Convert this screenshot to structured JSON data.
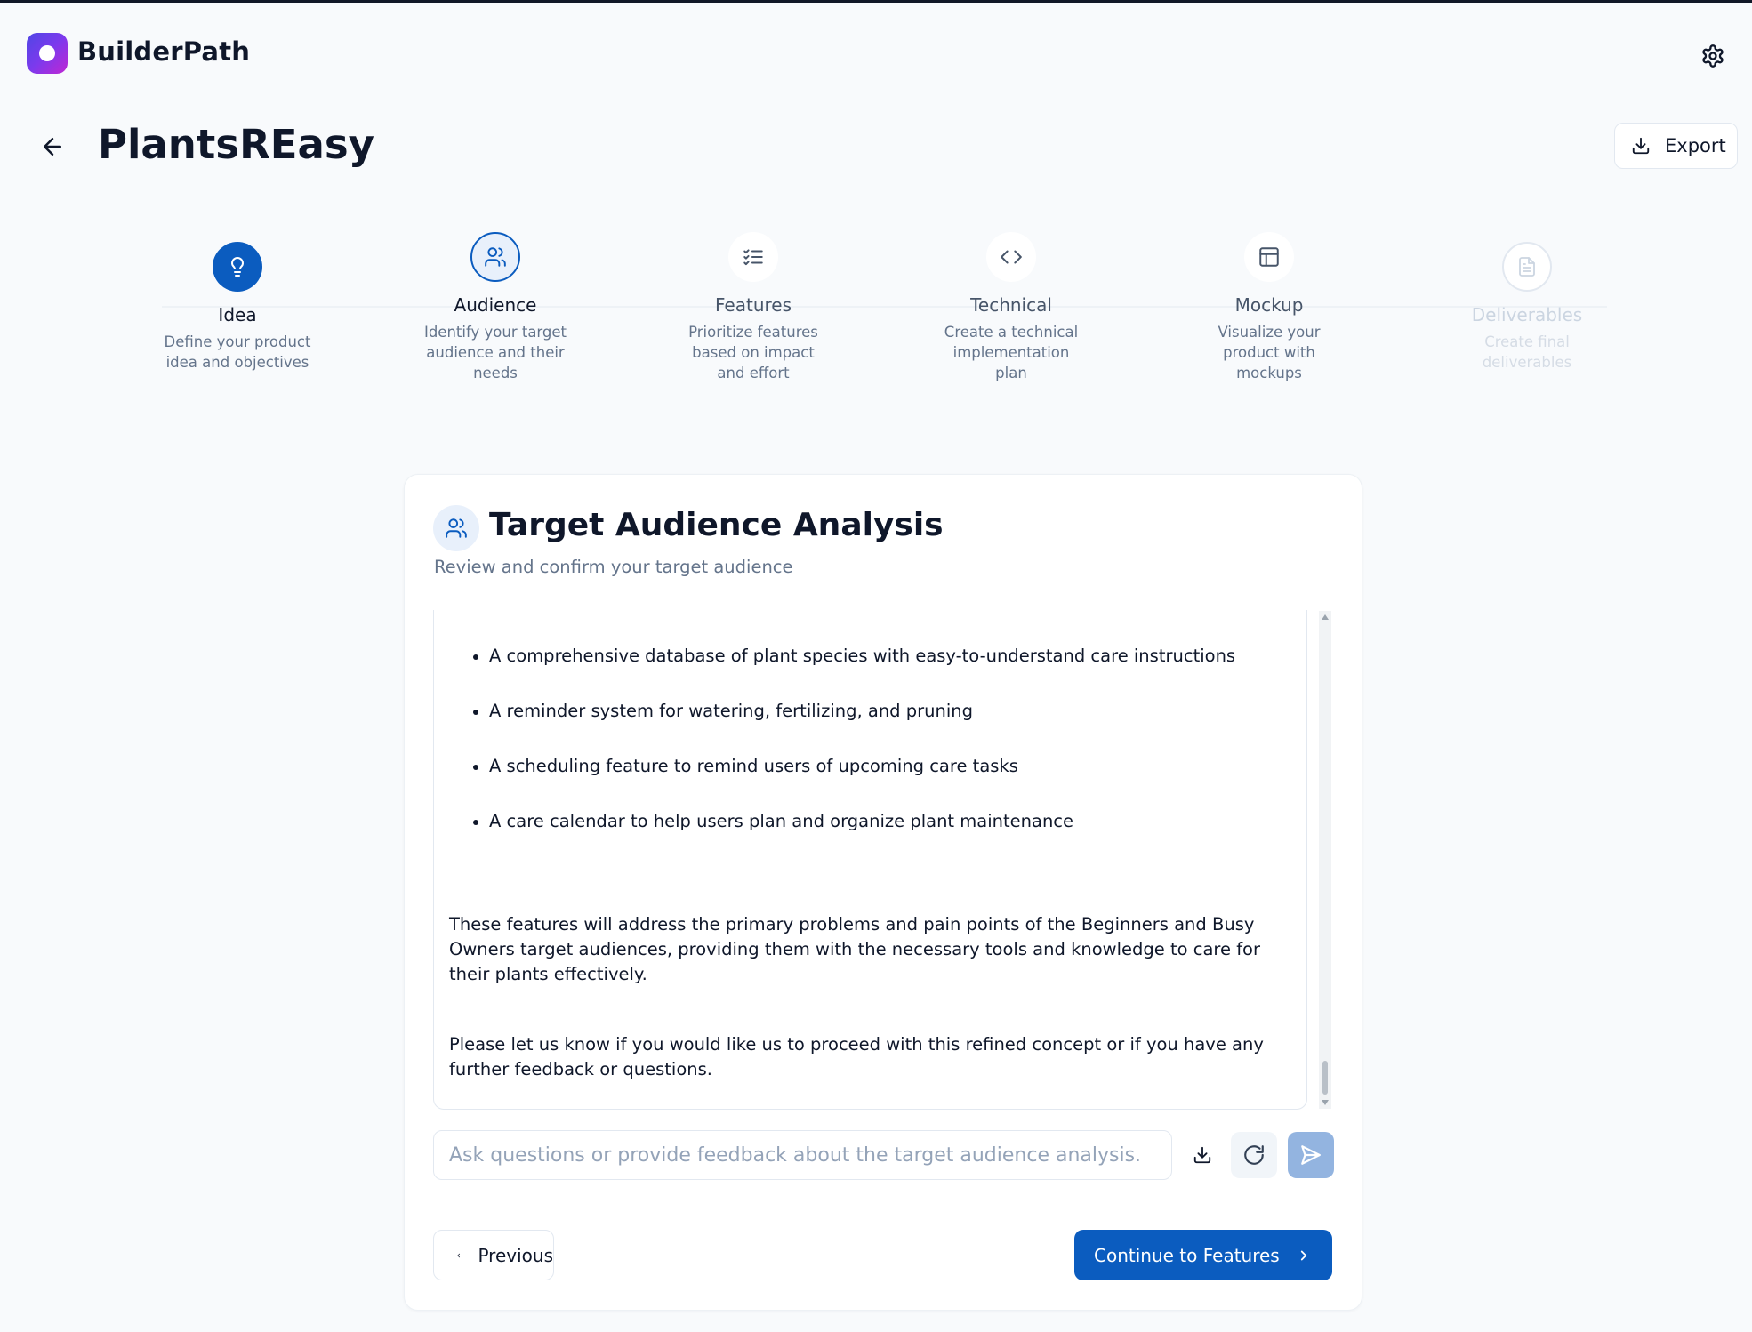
{
  "app": {
    "brand": "BuilderPath"
  },
  "project": {
    "title": "PlantsREasy",
    "export_label": "Export"
  },
  "steps": [
    {
      "title": "Idea",
      "description": "Define your product idea and objectives",
      "status": "completed"
    },
    {
      "title": "Audience",
      "description": "Identify your target audience and their needs",
      "status": "current"
    },
    {
      "title": "Features",
      "description": "Prioritize features based on impact and effort",
      "status": "upcoming"
    },
    {
      "title": "Technical",
      "description": "Create a technical implementation plan",
      "status": "upcoming"
    },
    {
      "title": "Mockup",
      "description": "Visualize your product with mockups",
      "status": "upcoming"
    },
    {
      "title": "Deliverables",
      "description": "Create final deliverables",
      "status": "disabled"
    }
  ],
  "card": {
    "title": "Target Audience Analysis",
    "subtitle": "Review and confirm your target audience",
    "features": [
      "A comprehensive database of plant species with easy-to-understand care instructions",
      "A reminder system for watering, fertilizing, and pruning",
      "A scheduling feature to remind users of upcoming care tasks",
      "A care calendar to help users plan and organize plant maintenance"
    ],
    "paragraph1": "These features will address the primary problems and pain points of the Beginners and Busy Owners target audiences, providing them with the necessary tools and knowledge to care for their plants effectively.",
    "paragraph2": "Please let us know if you would like us to proceed with this refined concept or if you have any further feedback or questions."
  },
  "feedback": {
    "placeholder": "Ask questions or provide feedback about the target audience analysis.",
    "value": ""
  },
  "nav": {
    "previous_label": "Previous",
    "next_label": "Continue to Features"
  },
  "colors": {
    "primary": "#0b5cbf",
    "send_button": "#93b4e0",
    "text": "#0f172a",
    "muted": "#64748b",
    "disabled": "#cbd5e1"
  }
}
